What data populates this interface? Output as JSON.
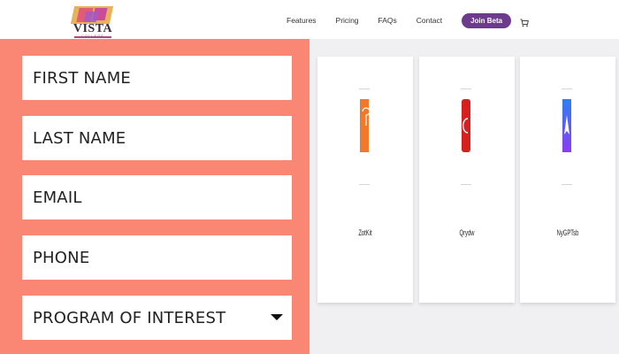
{
  "header": {
    "logo_text": "VISTA",
    "logo_sub": "COLLEGE",
    "nav": [
      "Features",
      "Pricing",
      "FAQs",
      "Contact"
    ],
    "join_label": "Join Beta",
    "cart_icon": "cart-icon"
  },
  "form": {
    "first_name": "FIRST NAME",
    "last_name": "LAST NAME",
    "email": "EMAIL",
    "phone": "PHONE",
    "program": "PROGRAM OF INTEREST",
    "program_icon": "chevron-down-icon",
    "panel_color": "#fa8674"
  },
  "cards": [
    {
      "label": "ZotKit",
      "color": "#f07a2a",
      "icon": "app-icon-orange"
    },
    {
      "label": "Qrydw",
      "color": "#d61f1f",
      "icon": "app-icon-red"
    },
    {
      "label": "NyGPTsb",
      "color": "#6a4cf0",
      "icon": "app-icon-purple"
    }
  ],
  "colors": {
    "accent": "#6d3b8c"
  }
}
